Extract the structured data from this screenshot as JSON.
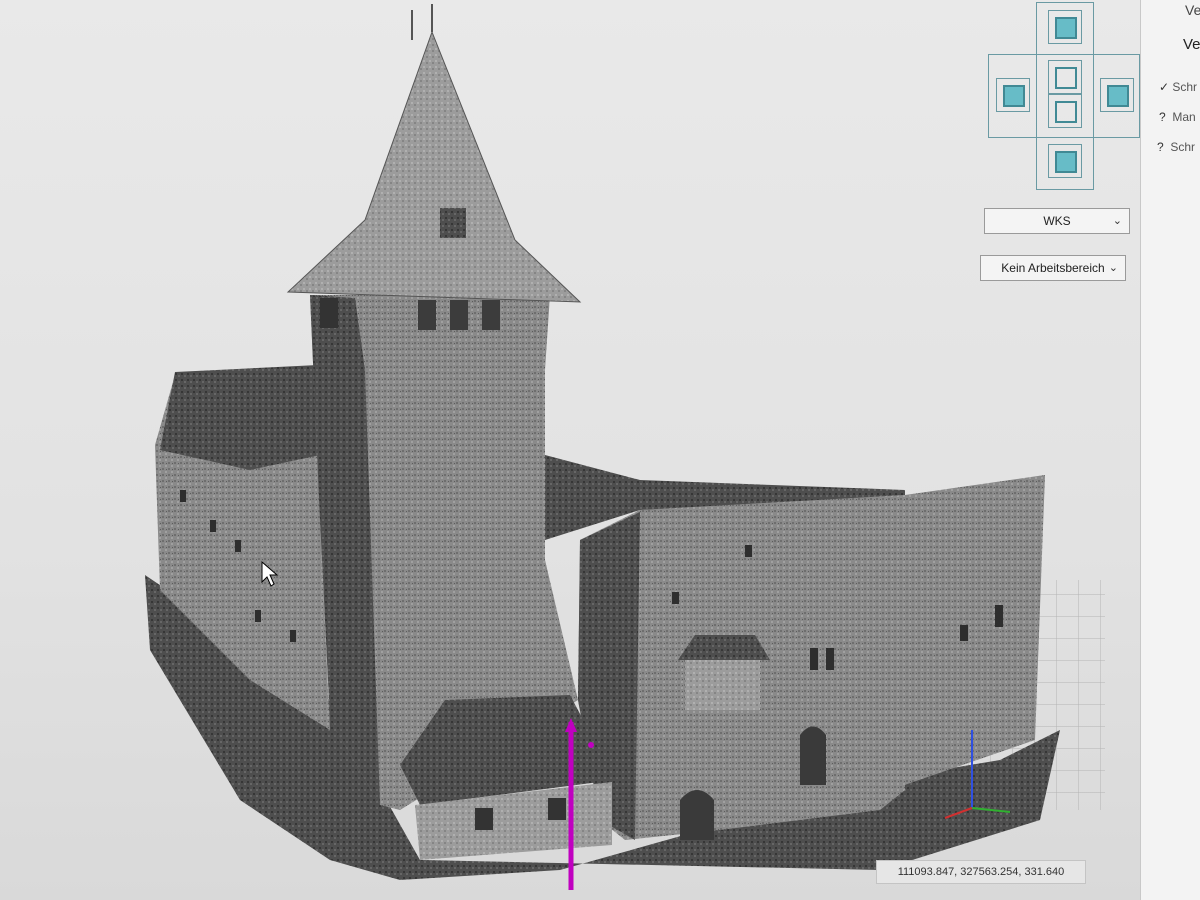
{
  "panel": {
    "title": "Ve",
    "subtitle": "Ve",
    "options": [
      {
        "mark": "✓",
        "label": "Schr"
      },
      {
        "mark": "?",
        "label": "Man"
      },
      {
        "mark": "?",
        "label": "Schr"
      }
    ]
  },
  "view_cube": {
    "faces": [
      "top",
      "left",
      "front",
      "right",
      "back",
      "bottom"
    ],
    "accent": "#5ab8c4"
  },
  "coordinate_system_dropdown": {
    "value": "WKS"
  },
  "workspace_dropdown": {
    "value": "Kein Arbeitsbereich"
  },
  "coordinates": {
    "readout": "111093.847, 327563.254, 331.640"
  },
  "colors": {
    "axis_vertical": "#c000c0",
    "axis_x": "#d03030",
    "axis_y": "#30b030",
    "axis_z": "#3050e0"
  }
}
